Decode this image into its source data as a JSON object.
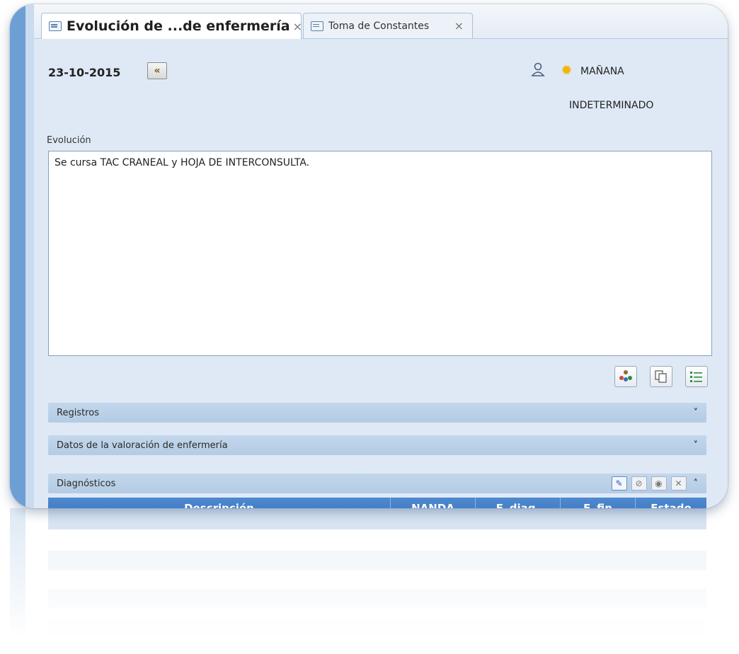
{
  "tabs": [
    {
      "label": "Evolución de ...de enfermería",
      "close": "×"
    },
    {
      "label": "Toma de Constantes",
      "close": "×"
    }
  ],
  "header": {
    "date": "23-10-2015",
    "back_glyph": "«",
    "shift": "MAÑANA",
    "status": "INDETERMINADO"
  },
  "evolution": {
    "label": "Evolución",
    "text": "Se cursa TAC CRANEAL y HOJA DE INTERCONSULTA."
  },
  "sections": {
    "registros": {
      "label": "Registros",
      "chevron": "˅"
    },
    "datos": {
      "label": "Datos de la valoración de enfermería",
      "chevron": "˅"
    },
    "diagnosticos": {
      "label": "Diagnósticos",
      "chevron": "˄"
    }
  },
  "table": {
    "columns": [
      "Descripción",
      "NANDA",
      "F. diag.",
      "F. fin",
      "Estado"
    ]
  },
  "colors": {
    "accent": "#3a73bd",
    "panel": "#dfe9f6",
    "section": "#b3cbe4"
  },
  "icons": [
    "tab-document-icon",
    "back-arrow-icon",
    "user-icon",
    "sun-icon",
    "users-group-icon",
    "copy-document-icon",
    "list-icon",
    "edit-icon",
    "disable-icon",
    "record-icon",
    "delete-icon"
  ]
}
